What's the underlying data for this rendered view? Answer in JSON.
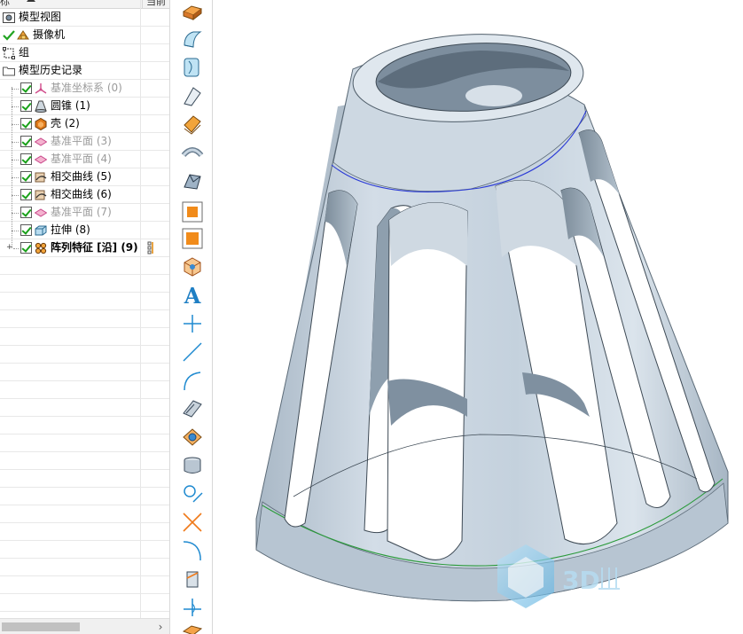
{
  "tree": {
    "header": {
      "col_name": "标",
      "col_current": "当前"
    },
    "items": [
      {
        "label": "模型视图",
        "style": "normal",
        "icon": "model-view-icon",
        "checked": false
      },
      {
        "label": "摄像机",
        "style": "normal",
        "icon": "camera-icon",
        "checked": true
      },
      {
        "label": "组",
        "style": "normal",
        "icon": "group-icon",
        "checked": false
      },
      {
        "label": "模型历史记录",
        "style": "normal",
        "icon": "folder-icon",
        "checked": false
      },
      {
        "label": "基准坐标系 (0)",
        "style": "gray",
        "icon": "datum-csys-icon",
        "checked": true
      },
      {
        "label": "圆锥 (1)",
        "style": "normal",
        "icon": "cone-icon",
        "checked": true
      },
      {
        "label": "壳 (2)",
        "style": "normal",
        "icon": "shell-icon",
        "checked": true
      },
      {
        "label": "基准平面 (3)",
        "style": "gray",
        "icon": "datum-plane-icon",
        "checked": true
      },
      {
        "label": "基准平面 (4)",
        "style": "gray",
        "icon": "datum-plane-icon",
        "checked": true
      },
      {
        "label": "相交曲线 (5)",
        "style": "normal",
        "icon": "intersect-curve-icon",
        "checked": true
      },
      {
        "label": "相交曲线 (6)",
        "style": "normal",
        "icon": "intersect-curve-icon",
        "checked": true
      },
      {
        "label": "基准平面 (7)",
        "style": "gray",
        "icon": "datum-plane-icon",
        "checked": true
      },
      {
        "label": "拉伸 (8)",
        "style": "normal",
        "icon": "extrude-icon",
        "checked": true
      },
      {
        "label": "阵列特征 [沿] (9)",
        "style": "bold",
        "icon": "pattern-feature-icon",
        "checked": true
      }
    ]
  },
  "toolbar": {
    "tools": [
      "extrude-surface-icon",
      "sweep-surface-icon",
      "revolve-surface-icon",
      "ruled-surface-icon",
      "offset-surface-icon",
      "pipe-icon",
      "fill-surface-icon",
      "box-orange-icon",
      "square-orange-icon",
      "cube-sketch-icon",
      "text-icon",
      "point-cross-icon",
      "line-icon",
      "arc-icon",
      "plane-face-icon",
      "datum-face-icon",
      "cylinder-icon",
      "circle-line-icon",
      "x-cross-icon",
      "curve-corner-icon",
      "cylinder-cut-icon",
      "point-plus-icon",
      "shape-bottom-icon"
    ]
  },
  "viewport": {
    "model": "cone-shell-with-slots",
    "colors": {
      "body": "#c6d3df",
      "shade": "#9fb0c0",
      "dark": "#6e7e8d",
      "edge": "#2a2a2a",
      "curve_blue": "#2b3bd6",
      "curve_green": "#2a9a3a"
    },
    "watermark_text": "3D"
  }
}
